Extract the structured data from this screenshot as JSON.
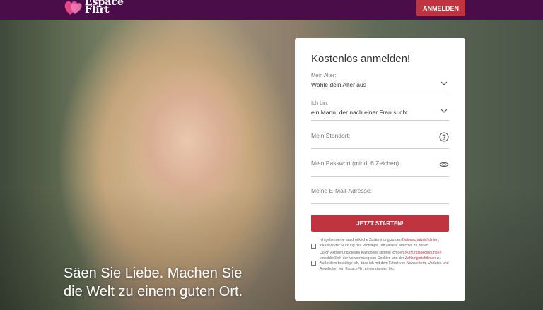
{
  "brand": {
    "name_line1": "Espace",
    "name_line2": "Flirt",
    "accent": "#c0343f",
    "topbar": "#4a0d4a"
  },
  "header": {
    "login_label": "ANMELDEN"
  },
  "hero": {
    "tagline_line1": "Säen Sie Liebe. Machen Sie",
    "tagline_line2": "die Welt zu einem guten Ort."
  },
  "form": {
    "title": "Kostenlos anmelden!",
    "age": {
      "label": "Mein Alter:",
      "value": "Wähle dein Alter aus"
    },
    "gender": {
      "label": "Ich bin:",
      "value": "ein Mann, der nach einer Frau sucht"
    },
    "location": {
      "placeholder": "Mein Standort:",
      "icon": "help-circle-icon"
    },
    "password": {
      "placeholder": "Mein Passwort (mind. 6 Zeichen)",
      "icon": "eye-icon"
    },
    "email": {
      "placeholder": "Meine E-Mail-Adresse:"
    },
    "submit_label": "JETZT STARTEN!",
    "consent1": {
      "pre": "Ich gebe meine ausdrückliche Zustimmung zu den",
      "link": "Datenschutzrichtlinien",
      "post": ", inklusive der Nutzung des Profilings, um weitere Matches zu finden."
    },
    "consent2": {
      "pre": "Durch Aktivierung dieses Kästchens stimme ich den",
      "link1": "Nutzungsbedingungen",
      "mid": "einschließlich der Verwendung von Cookies und der",
      "link2": "Zahlungsrichtlinien",
      "post": "zu. Außerdem bestätige ich, dass ich mit dem Erhalt von Newslettern, Updates und Angeboten von EspaceFlirt einverstanden bin."
    }
  }
}
